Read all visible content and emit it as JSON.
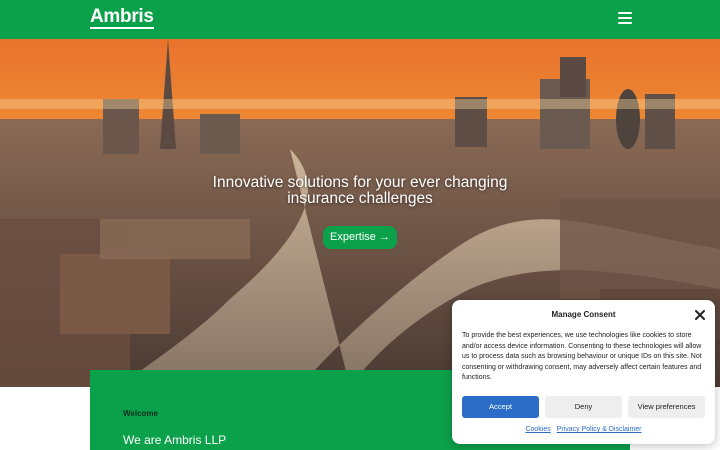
{
  "header": {
    "logo": "Ambris",
    "menu_icon": "hamburger-menu-icon"
  },
  "hero": {
    "title_line1": "Innovative solutions for your ever changing",
    "title_line2": "insurance challenges",
    "cta_label": "Expertise →"
  },
  "welcome": {
    "label": "Welcome",
    "heading": "We are Ambris LLP"
  },
  "consent": {
    "title": "Manage Consent",
    "body": "To provide the best experiences, we use technologies like cookies to store and/or access device information. Consenting to these technologies will allow us to process data such as browsing behaviour or unique IDs on this site. Not consenting or withdrawing consent, may adversely affect certain features and functions.",
    "accept_label": "Accept",
    "deny_label": "Deny",
    "preferences_label": "View preferences",
    "cookies_link": "Cookies",
    "policy_link": "Privacy Policy & Disclaimer"
  },
  "colors": {
    "brand_green": "#0ba14a",
    "accept_blue": "#2b6cc7"
  }
}
